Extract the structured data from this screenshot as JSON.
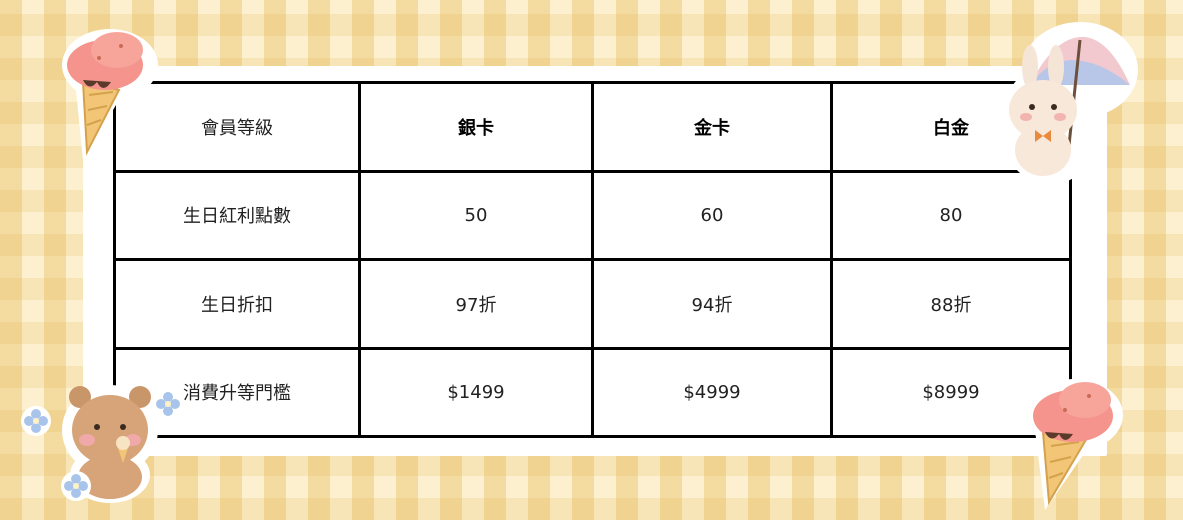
{
  "table": {
    "header": {
      "label": "會員等級",
      "tiers": [
        "銀卡",
        "金卡",
        "白金"
      ]
    },
    "rows": [
      {
        "label": "生日紅利點數",
        "values": [
          "50",
          "60",
          "80"
        ]
      },
      {
        "label": "生日折扣",
        "values": [
          "97折",
          "94折",
          "88折"
        ]
      },
      {
        "label": "消費升等門檻",
        "values": [
          "$1499",
          "$4999",
          "$8999"
        ]
      }
    ]
  },
  "decorations": {
    "top_left": "ice-cream-icon",
    "top_right": "bunny-umbrella-icon",
    "bottom_left": "bear-ice-cream-icon",
    "bottom_right": "ice-cream-icon",
    "flowers": "flower-icon"
  },
  "colors": {
    "background": "#f7e6b8",
    "card": "#ffffff",
    "grid": "#000000"
  }
}
